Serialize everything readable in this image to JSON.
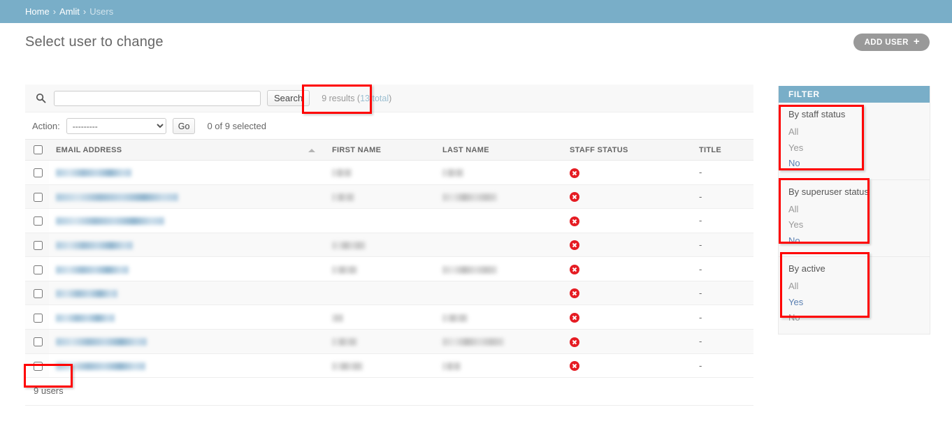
{
  "breadcrumbs": {
    "home": "Home",
    "app": "Amlit",
    "current": "Users",
    "separator": "›"
  },
  "header": {
    "page_title": "Select user to change",
    "add_button_label": "ADD USER",
    "add_button_icon": "plus-icon"
  },
  "search": {
    "icon": "search-icon",
    "value": "",
    "placeholder": "",
    "button_label": "Search",
    "result_count_prefix": "9 results (",
    "result_count_total": "13 total",
    "result_count_suffix": ")"
  },
  "actions": {
    "label": "Action:",
    "selected_option": "---------",
    "options": [
      "---------"
    ],
    "go_label": "Go",
    "counter": "0 of 9 selected"
  },
  "table": {
    "columns": [
      {
        "key": "check",
        "label": ""
      },
      {
        "key": "email",
        "label": "EMAIL ADDRESS",
        "sorted": "asc"
      },
      {
        "key": "first",
        "label": "FIRST NAME"
      },
      {
        "key": "last",
        "label": "LAST NAME"
      },
      {
        "key": "staff",
        "label": "STAFF STATUS"
      },
      {
        "key": "title",
        "label": "TITLE"
      }
    ],
    "rows": [
      {
        "email_w": 108,
        "first_w": 28,
        "last_w": 30,
        "staff": "false-icon",
        "title": "-"
      },
      {
        "email_w": 175,
        "first_w": 32,
        "last_w": 78,
        "staff": "false-icon",
        "title": "-"
      },
      {
        "email_w": 155,
        "first_w": 0,
        "last_w": 0,
        "staff": "false-icon",
        "title": "-"
      },
      {
        "email_w": 110,
        "first_w": 48,
        "last_w": 0,
        "staff": "false-icon",
        "title": "-"
      },
      {
        "email_w": 104,
        "first_w": 36,
        "last_w": 78,
        "staff": "false-icon",
        "title": "-"
      },
      {
        "email_w": 88,
        "first_w": 0,
        "last_w": 0,
        "staff": "false-icon",
        "title": "-"
      },
      {
        "email_w": 84,
        "first_w": 16,
        "last_w": 36,
        "staff": "false-icon",
        "title": "-"
      },
      {
        "email_w": 130,
        "first_w": 36,
        "last_w": 88,
        "staff": "false-icon",
        "title": "-"
      },
      {
        "email_w": 128,
        "first_w": 44,
        "last_w": 26,
        "staff": "false-icon",
        "title": "-"
      }
    ]
  },
  "paginator": {
    "count_label": "9 users"
  },
  "filter": {
    "title": "FILTER",
    "groups": [
      {
        "heading": "By staff status",
        "options": [
          {
            "label": "All",
            "selected": false
          },
          {
            "label": "Yes",
            "selected": false
          },
          {
            "label": "No",
            "selected": true
          }
        ]
      },
      {
        "heading": "By superuser status",
        "options": [
          {
            "label": "All",
            "selected": false
          },
          {
            "label": "Yes",
            "selected": false
          },
          {
            "label": "No",
            "selected": true
          }
        ]
      },
      {
        "heading": "By active",
        "options": [
          {
            "label": "All",
            "selected": false
          },
          {
            "label": "Yes",
            "selected": true
          },
          {
            "label": "No",
            "selected": false
          }
        ]
      }
    ]
  },
  "colors": {
    "brand_blue": "#79aec8",
    "link_blue": "#5b80b2",
    "muted": "#999999",
    "annotation_red": "#ff0000",
    "status_false_red": "#e51c23"
  }
}
